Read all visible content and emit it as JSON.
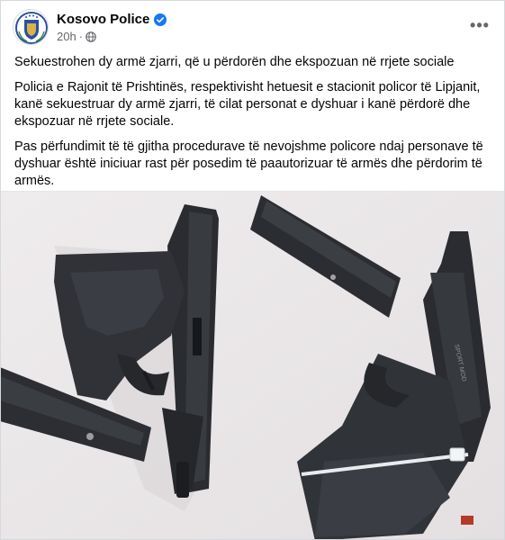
{
  "post": {
    "page_name": "Kosovo Police",
    "timestamp": "20h",
    "separator": "·",
    "more_label": "•••",
    "paragraphs": [
      "Sekuestrohen dy armë zjarri, që u përdorën dhe ekspozuan në rrjete sociale",
      "Policia e Rajonit të Prishtinës, respektivisht hetuesit e stacionit  policor të Lipjanit,\nkanë sekuestruar  dy armë zjarri,  të cilat personat e dyshuar i kanë përdorë dhe\nekspozuar në rrjete sociale.",
      "Pas përfundimit të të gjitha procedurave të nevojshme policore ndaj personave të\ndyshuar është  iniciuar rast për posedim të paautorizuar të armës dhe  përdorim të\narmës."
    ]
  },
  "photo": {
    "gun_marking": "SPORT MOD"
  },
  "icons": {
    "avatar": "kosovo-police-emblem",
    "verified": "verified-badge-icon",
    "audience": "globe-icon",
    "more": "more-options-icon"
  },
  "colors": {
    "verified": "#1877f2",
    "secondary_text": "#65676b",
    "photo_background": "#ece9ea",
    "weapon": "#2a2c30"
  }
}
